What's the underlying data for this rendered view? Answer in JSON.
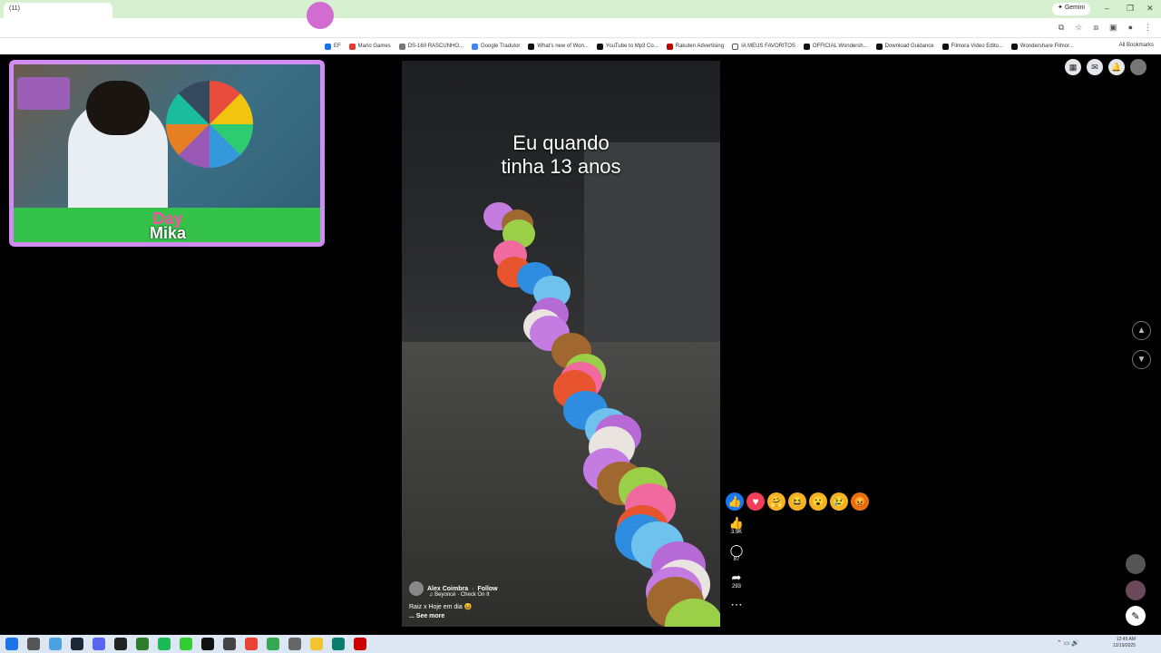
{
  "browser": {
    "tab_title": "(11)",
    "gemini_label": "Gemini",
    "bookmarks": [
      "EF",
      "Mario Games",
      "DS-160 RASCUNHO...",
      "Google Tradutor",
      "What's new of Won...",
      "YouTube to Mp3 Co...",
      "Rakuten Advertising",
      "IA MEUS FAVORITOS",
      "OFFICIAL Wondersh...",
      "Download Guidance",
      "Filmora Video Edito...",
      "Wondershare Filmor..."
    ],
    "all_bookmarks": "All Bookmarks"
  },
  "video": {
    "caption_line1": "Eu quando",
    "caption_line2": "tinha 13 anos",
    "author": "Alex Coimbra",
    "follow": "Follow",
    "music": "Beyoncé · Check On It",
    "post_text": "Raiz x Hoje em dia 😆",
    "see_more": "... See more"
  },
  "actions": {
    "likes": "3.9K",
    "comments": "87",
    "shares": "293"
  },
  "overlay": {
    "day": "Day",
    "mika": "Mika"
  },
  "clock": {
    "time": "12:45 AM",
    "date": "12/19/2025"
  },
  "colors": {
    "chrome_green": "#d7f1d0",
    "overlay_border": "#d28bf0",
    "overlay_green": "#34c24a",
    "like_blue": "#1877f2"
  }
}
